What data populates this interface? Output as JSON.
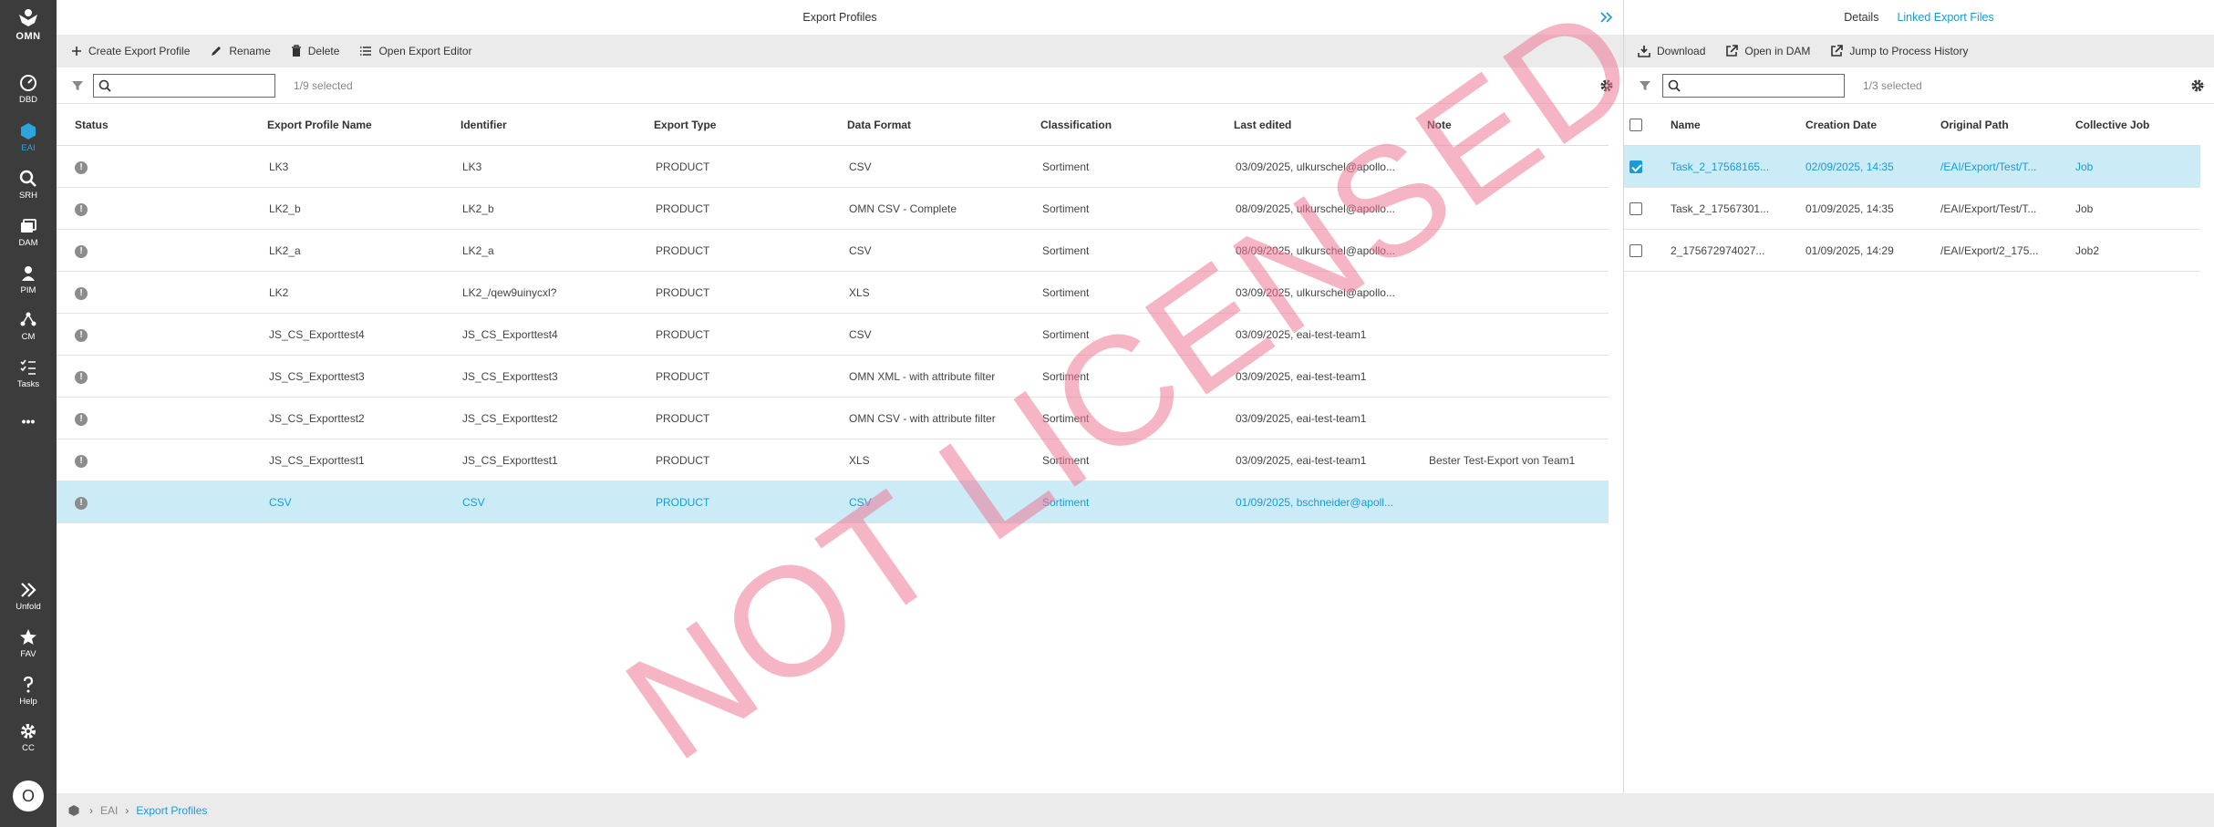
{
  "app": {
    "logo_text": "OMN"
  },
  "nav": {
    "items": [
      {
        "label": "DBD"
      },
      {
        "label": "EAI"
      },
      {
        "label": "SRH"
      },
      {
        "label": "DAM"
      },
      {
        "label": "PIM"
      },
      {
        "label": "CM"
      },
      {
        "label": "Tasks"
      },
      {
        "label": "•••"
      }
    ],
    "bottom": [
      {
        "label": "Unfold"
      },
      {
        "label": "FAV"
      },
      {
        "label": "Help"
      },
      {
        "label": "CC"
      }
    ],
    "avatar": "O"
  },
  "main": {
    "title": "Export Profiles",
    "toolbar": {
      "create": "Create Export Profile",
      "rename": "Rename",
      "delete": "Delete",
      "open_editor": "Open Export Editor"
    },
    "search_placeholder": "",
    "selected_count": "1/9 selected",
    "columns": [
      "Status",
      "Export Profile Name",
      "Identifier",
      "Export Type",
      "Data Format",
      "Classification",
      "Last edited",
      "Note"
    ],
    "rows": [
      {
        "status": "!",
        "name": "LK3",
        "identifier": "LK3",
        "type": "PRODUCT",
        "format": "CSV",
        "classification": "Sortiment",
        "edited": "03/09/2025, ulkurschel@apollo...",
        "note": ""
      },
      {
        "status": "!",
        "name": "LK2_b",
        "identifier": "LK2_b",
        "type": "PRODUCT",
        "format": "OMN CSV - Complete",
        "classification": "Sortiment",
        "edited": "08/09/2025, ulkurschel@apollo...",
        "note": ""
      },
      {
        "status": "!",
        "name": "LK2_a",
        "identifier": "LK2_a",
        "type": "PRODUCT",
        "format": "CSV",
        "classification": "Sortiment",
        "edited": "08/09/2025, ulkurschel@apollo...",
        "note": ""
      },
      {
        "status": "!",
        "name": "LK2",
        "identifier": "LK2_/qew9uinycxl?",
        "type": "PRODUCT",
        "format": "XLS",
        "classification": "Sortiment",
        "edited": "03/09/2025, ulkurschel@apollo...",
        "note": ""
      },
      {
        "status": "!",
        "name": "JS_CS_Exporttest4",
        "identifier": "JS_CS_Exporttest4",
        "type": "PRODUCT",
        "format": "CSV",
        "classification": "Sortiment",
        "edited": "03/09/2025, eai-test-team1",
        "note": ""
      },
      {
        "status": "!",
        "name": "JS_CS_Exporttest3",
        "identifier": "JS_CS_Exporttest3",
        "type": "PRODUCT",
        "format": "OMN XML - with attribute filter",
        "classification": "Sortiment",
        "edited": "03/09/2025, eai-test-team1",
        "note": ""
      },
      {
        "status": "!",
        "name": "JS_CS_Exporttest2",
        "identifier": "JS_CS_Exporttest2",
        "type": "PRODUCT",
        "format": "OMN CSV - with attribute filter",
        "classification": "Sortiment",
        "edited": "03/09/2025, eai-test-team1",
        "note": ""
      },
      {
        "status": "!",
        "name": "JS_CS_Exporttest1",
        "identifier": "JS_CS_Exporttest1",
        "type": "PRODUCT",
        "format": "XLS",
        "classification": "Sortiment",
        "edited": "03/09/2025, eai-test-team1",
        "note": "Bester Test-Export von Team1"
      },
      {
        "status": "!",
        "name": "CSV",
        "identifier": "CSV",
        "type": "PRODUCT",
        "format": "CSV",
        "classification": "Sortiment",
        "edited": "01/09/2025, bschneider@apoll...",
        "note": ""
      }
    ],
    "selected_row": 8
  },
  "right": {
    "tabs": [
      {
        "label": "Details"
      },
      {
        "label": "Linked Export Files"
      }
    ],
    "active_tab": 1,
    "toolbar": {
      "download": "Download",
      "open_dam": "Open in DAM",
      "jump_history": "Jump to Process History"
    },
    "selected_count": "1/3 selected",
    "columns": [
      "Name",
      "Creation Date",
      "Original Path",
      "Collective Job"
    ],
    "rows": [
      {
        "name": "Task_2_17568165...",
        "date": "02/09/2025, 14:35",
        "path": "/EAI/Export/Test/T...",
        "job": "Job",
        "checked": true
      },
      {
        "name": "Task_2_17567301...",
        "date": "01/09/2025, 14:35",
        "path": "/EAI/Export/Test/T...",
        "job": "Job",
        "checked": false
      },
      {
        "name": "2_175672974027...",
        "date": "01/09/2025, 14:29",
        "path": "/EAI/Export/2_175...",
        "job": "Job2",
        "checked": false
      }
    ]
  },
  "breadcrumb": [
    "EAI",
    "Export Profiles"
  ],
  "watermark": "NOT LICENSED",
  "colors": {
    "accent": "#1a9bd6",
    "rail": "#3c3c3c",
    "selected_row": "#cbebf7",
    "watermark": "#ec7896"
  }
}
